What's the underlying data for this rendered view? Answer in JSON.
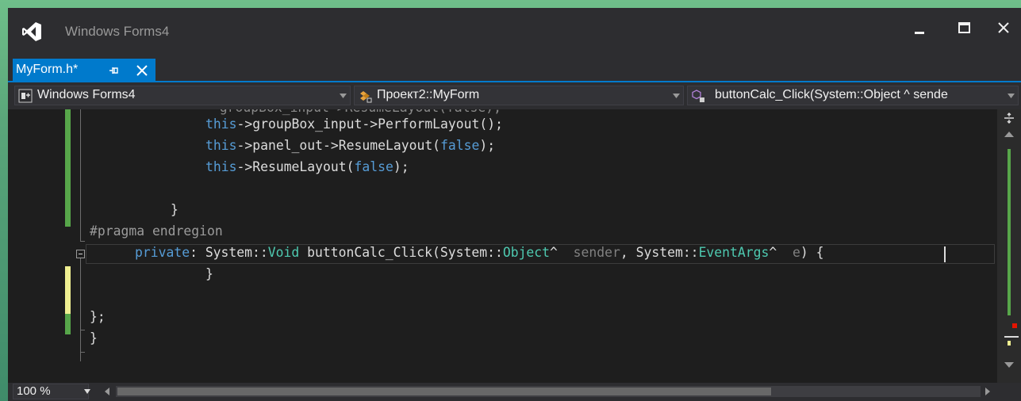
{
  "window": {
    "title": "Windows Forms4"
  },
  "tab": {
    "label": "MyForm.h*"
  },
  "nav": {
    "project": "Windows Forms4",
    "class": "Проект2::MyForm",
    "member": "buttonCalc_Click(System::Object ^ sende"
  },
  "code": {
    "line1": [
      {
        "t": "this",
        "c": "kw"
      },
      {
        "t": "->groupBox_input->PerformLayout();",
        "c": ""
      }
    ],
    "line2": [
      {
        "t": "this",
        "c": "kw"
      },
      {
        "t": "->panel_out->ResumeLayout(",
        "c": ""
      },
      {
        "t": "false",
        "c": "kw"
      },
      {
        "t": ");",
        "c": ""
      }
    ],
    "line3": [
      {
        "t": "this",
        "c": "kw"
      },
      {
        "t": "->ResumeLayout(",
        "c": ""
      },
      {
        "t": "false",
        "c": "kw"
      },
      {
        "t": ");",
        "c": ""
      }
    ],
    "line5": "}",
    "line6": "#pragma endregion",
    "line7": [
      {
        "t": "private",
        "c": "kw"
      },
      {
        "t": ": System::",
        "c": ""
      },
      {
        "t": "Void",
        "c": "ty"
      },
      {
        "t": " buttonCalc_Click(System::",
        "c": ""
      },
      {
        "t": "Object",
        "c": "ty"
      },
      {
        "t": "^  ",
        "c": ""
      },
      {
        "t": "sender",
        "c": "param"
      },
      {
        "t": ", System::",
        "c": ""
      },
      {
        "t": "EventArgs",
        "c": "ty"
      },
      {
        "t": "^  ",
        "c": ""
      },
      {
        "t": "e",
        "c": "param"
      },
      {
        "t": ") {",
        "c": ""
      }
    ],
    "line8": "}",
    "line10": "};",
    "line11": "}"
  },
  "status": {
    "zoom": "100 %"
  },
  "colors": {
    "accent": "#007acc",
    "keyword": "#569cd6",
    "type": "#4ec9b0",
    "saved_change": "#57a64a",
    "unsaved_change": "#efef91"
  },
  "icons": {
    "logo": "visual-studio-logo-icon",
    "project": "cpp-project-icon",
    "class": "class-icon",
    "member": "method-icon"
  }
}
